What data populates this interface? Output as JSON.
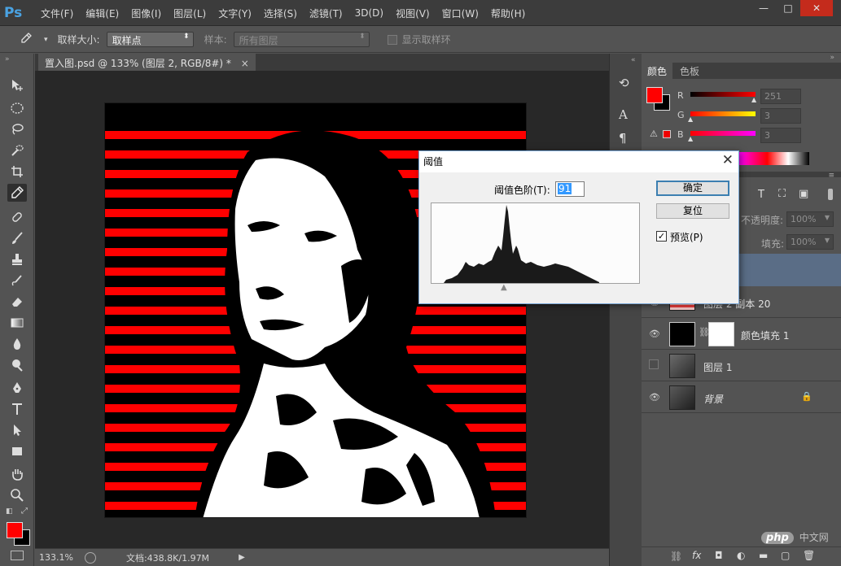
{
  "app": {
    "logo": "Ps",
    "menu": [
      "文件(F)",
      "编辑(E)",
      "图像(I)",
      "图层(L)",
      "文字(Y)",
      "选择(S)",
      "滤镜(T)",
      "3D(D)",
      "视图(V)",
      "窗口(W)",
      "帮助(H)"
    ],
    "window_buttons": {
      "minimize": "—",
      "maximize": "□",
      "close": "✕"
    }
  },
  "options": {
    "sample_size_label": "取样大小:",
    "sample_size_value": "取样点",
    "sample_label": "样本:",
    "sample_value": "所有图层",
    "show_ring_label": "显示取样环"
  },
  "document": {
    "tab_title": "置入图.psd @ 133% (图层 2, RGB/8#) *",
    "tab_close": "×",
    "zoom": "133.1%",
    "doc_size": "文档:438.8K/1.97M"
  },
  "color_panel": {
    "tabs": [
      "颜色",
      "色板"
    ],
    "foreground_color": "#ff0000",
    "background_color": "#000000",
    "channels": [
      {
        "letter": "R",
        "value": "251"
      },
      {
        "letter": "G",
        "value": "3"
      },
      {
        "letter": "B",
        "value": "3"
      }
    ]
  },
  "layers_panel": {
    "opacity_label": "不透明度:",
    "opacity_value": "100%",
    "fill_label": "填充:",
    "fill_value": "100%",
    "layers": [
      {
        "name": "图层 2 副本 20",
        "visible": true
      },
      {
        "name": "颜色填充 1",
        "visible": true
      },
      {
        "name": "图层 1",
        "visible": false
      },
      {
        "name": "背景",
        "visible": true
      }
    ]
  },
  "dialog": {
    "title": "阈值",
    "level_label": "阈值色阶(T):",
    "level_value": "91",
    "ok_label": "确定",
    "reset_label": "复位",
    "preview_label": "预览(P)",
    "preview_checked": true,
    "close": "✕"
  },
  "watermark": {
    "logo": "php",
    "text": "中文网"
  }
}
